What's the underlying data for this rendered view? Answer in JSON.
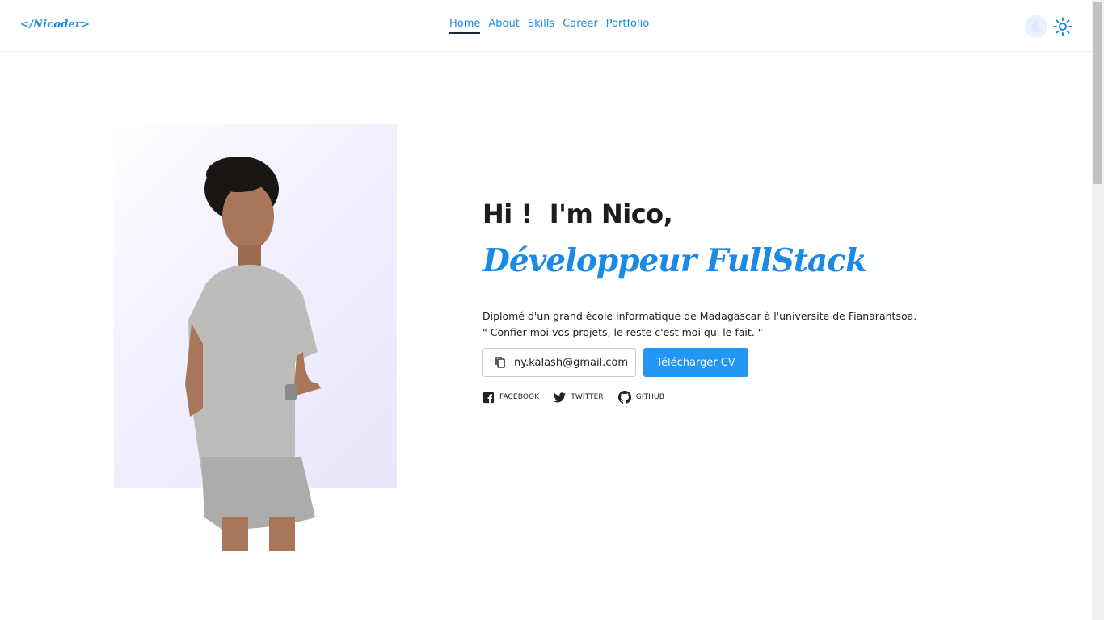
{
  "header": {
    "logo": "</Nicoder>",
    "nav": [
      {
        "label": "Home",
        "active": true
      },
      {
        "label": "About",
        "active": false
      },
      {
        "label": "Skills",
        "active": false
      },
      {
        "label": "Career",
        "active": false
      },
      {
        "label": "Portfolio",
        "active": false
      }
    ],
    "theme_icons": [
      "moon-icon",
      "sun-icon"
    ]
  },
  "hero": {
    "greeting": "Hi !  I'm Nico,",
    "role": "Développeur FullStack",
    "description_line1": "Diplomé d'un grand école informatique de Madagascar à l'universite de Fianarantsoa.",
    "description_line2": "\" Confier moi vos projets, le reste c'est moi qui le fait. \"",
    "email": "ny.kalash@gmail.com",
    "cv_button": "Télécharger CV",
    "socials": [
      {
        "label": "FACEBOOK",
        "icon": "facebook-icon"
      },
      {
        "label": "TWITTER",
        "icon": "twitter-icon"
      },
      {
        "label": "GITHUB",
        "icon": "github-icon"
      }
    ]
  },
  "colors": {
    "accent": "#1a8ae6",
    "button": "#2196f3",
    "text": "#222222"
  }
}
